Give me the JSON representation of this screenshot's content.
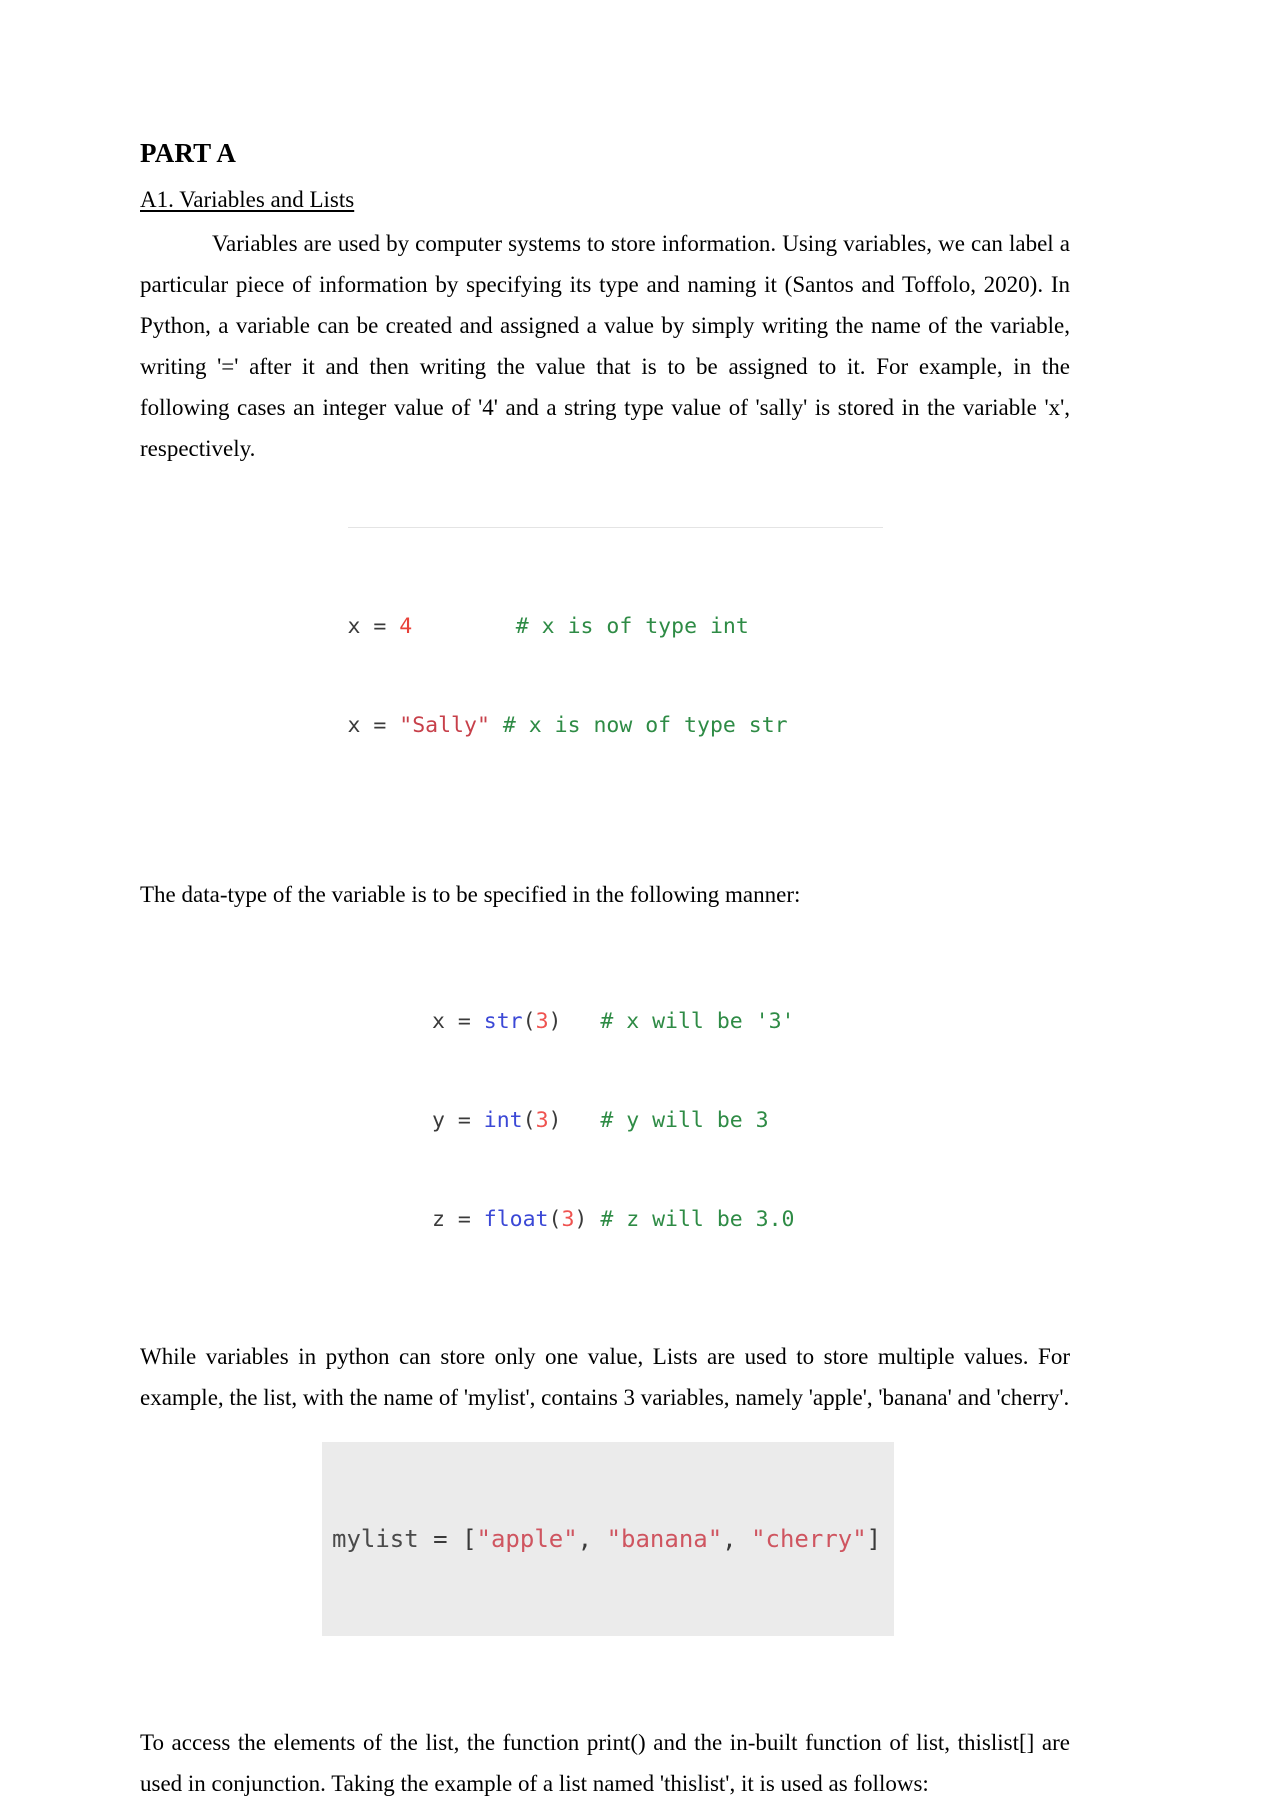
{
  "document": {
    "part_title": "PART A",
    "section_title": "A1. Variables and Lists",
    "paragraphs": {
      "p1": "Variables are used by computer systems to store information. Using variables, we can label a particular piece of information by specifying its type and naming it (Santos and Toffolo, 2020). In Python, a variable can be created and assigned a value by simply writing the name of the variable, writing '=' after it and then writing the value that is to be assigned to it. For example, in the following cases an integer value of '4' and a string type value of 'sally' is stored in the variable 'x', respectively.",
      "p2": "The data-type of the variable is to be specified in the following manner:",
      "p3": "While variables in python can store only one value, Lists are used to store multiple values. For example, the list, with the name of 'mylist', contains 3 variables, namely 'apple', 'banana' and 'cherry'.",
      "p4": "To access the elements of the list, the function print() and the in-built function of list, thislist[] are used in conjunction. Taking the example of a list named 'thislist', it is used as follows:"
    },
    "code_block_1": {
      "line1": {
        "code": "x = ",
        "value": "4",
        "gap": "        ",
        "comment": "# x is of type int"
      },
      "line2": {
        "code": "x = ",
        "value": "\"Sally\"",
        "gap": " ",
        "comment": "# x is now of type str"
      }
    },
    "code_block_2": {
      "line1": {
        "code": "x = ",
        "fn": "str",
        "open": "(",
        "value": "3",
        "close": ")",
        "gap": "   ",
        "comment": "# x will be '3'"
      },
      "line2": {
        "code": "y = ",
        "fn": "int",
        "open": "(",
        "value": "3",
        "close": ")",
        "gap": "   ",
        "comment": "# y will be 3"
      },
      "line3": {
        "code": "z = ",
        "fn": "float",
        "open": "(",
        "value": "3",
        "close": ")",
        "gap": " ",
        "comment": "# z will be 3.0"
      }
    },
    "code_block_3": {
      "var": "mylist",
      "eq": " = ",
      "bracket_open": "[",
      "item1": "\"apple\"",
      "sep1": ", ",
      "item2": "\"banana\"",
      "sep2": ", ",
      "item3": "\"cherry\"",
      "bracket_close": "]"
    }
  },
  "colors": {
    "code_string": "#c7404a",
    "code_number": "#e8413a",
    "code_comment": "#2e8b45",
    "code_function": "#3b48d6",
    "code_block_bg": "#ebebeb"
  }
}
